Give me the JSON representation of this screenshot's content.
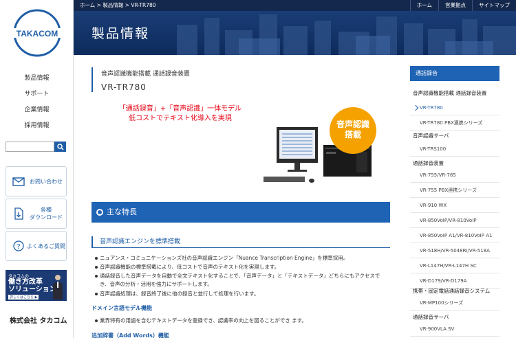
{
  "logo": {
    "text": "TAKACOM",
    "color": "#1f5ea6"
  },
  "sidebar": {
    "nav": [
      "製品情報",
      "サポート",
      "企業情報",
      "採用情報"
    ],
    "search": {
      "placeholder": ""
    },
    "boxes": [
      {
        "label": "お問い合わせ",
        "icon": "mail-icon"
      },
      {
        "label1": "各種",
        "label2": "ダウンロード",
        "icon": "download-icon"
      },
      {
        "label": "よくあるご質問",
        "icon": "question-icon"
      }
    ],
    "banner": {
      "line1": "タカコムの",
      "line2": "働き方改革",
      "line3": "ソリューション",
      "line4": "詳しくはこちら ▶"
    },
    "corp": "株式会社 タカコム"
  },
  "topbar": {
    "breadcrumb": "ホーム > 製品情報 > VR-TR780",
    "nav": [
      "ホーム",
      "営業拠点",
      "サイトマップ"
    ]
  },
  "hero": {
    "title": "製品情報"
  },
  "product": {
    "subtitle": "音声認識機能搭載 通話録音装置",
    "name": "VR-TR780",
    "catch1": "「通話録音」+「音声認識」一体モデル",
    "catch2": "低コストでテキスト化導入を実現",
    "badge1": "音声認識",
    "badge2": "搭載"
  },
  "features": {
    "title": "主な特長",
    "section1": "音声認識エンジンを標準搭載",
    "bullets1": [
      "ニュアンス・コミュニケーションズ社の音声認識エンジン「Nuance Transcription Engine」を標準採用。",
      "音声認識機能の標準搭載により、低コストで音声のテキスト化を実現します。",
      "通話録音した音声データを自動で全文テキスト化することで、「音声データ」と「テキストデータ」どちらにもアクセスでき、音声の分析・活用を強力にサポートします。",
      "音声認識処理は、録音終了後に他の録音と並行して処理を行います。"
    ],
    "section2": "ドメイン言語モデル機能",
    "bullets2": [
      "業界特有の用語を含むテキストデータを登録でき、認識率の向上を図ることができ ます。"
    ],
    "section3": "追加辞書（Add Words）機能"
  },
  "right": {
    "head": "通話録音",
    "groups": [
      {
        "cat": "音声認識機能搭載 通話録音装置",
        "items": [
          "VR-TR780",
          "VR-TR780 PBX連携シリーズ"
        ]
      },
      {
        "cat": "音声認識サーバ",
        "items": [
          "VR-TRS100"
        ]
      },
      {
        "cat": "通話録音装置",
        "items": [
          "VR-755/VR-765",
          "VR-755 PBX連携シリーズ",
          "VR-910 WX",
          "VR-850VoIP/VR-810VoIP",
          "VR-850VoIP A1/VR-810VoIP A1",
          "VR-518H/VR-5048RI/VR-518A",
          "VR-L147H/VR-L147H SC",
          "VR-D179/VR-D179A"
        ]
      },
      {
        "cat": "携帯・固定電話通話録音システム",
        "items": [
          "VR-MP100シリーズ"
        ]
      },
      {
        "cat": "通話録音サーバ",
        "items": [
          "VR-900VLA SV"
        ]
      }
    ]
  }
}
